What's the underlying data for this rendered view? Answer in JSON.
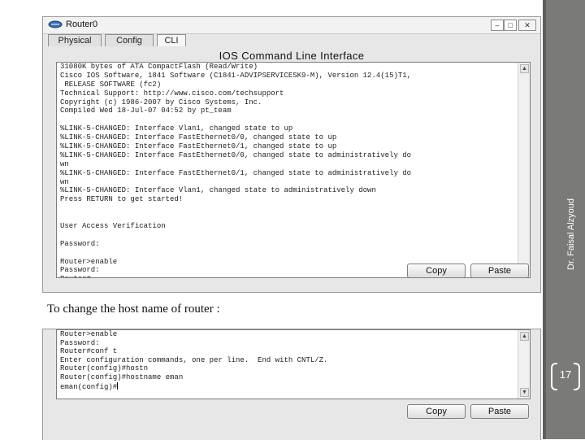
{
  "window1": {
    "title": "Router0",
    "controls": {
      "minimize": "–",
      "maximize": "□",
      "close": "✕"
    },
    "tabs": [
      "Physical",
      "Config",
      "CLI"
    ],
    "active_tab": "CLI",
    "heading": "IOS Command Line Interface",
    "terminal_lines": [
      "31080K bytes of ATA CompactFlash (Read/Write)",
      "Cisco IOS Software, 1841 Software (C1841-ADVIPSERVICESK9-M), Version 12.4(15)T1,",
      " RELEASE SOFTWARE (fc2)",
      "Technical Support: http://www.cisco.com/techsupport",
      "Copyright (c) 1986-2007 by Cisco Systems, Inc.",
      "Compiled Wed 18-Jul-07 04:52 by pt_team",
      "",
      "%LINK-5-CHANGED: Interface Vlan1, changed state to up",
      "%LINK-5-CHANGED: Interface FastEthernet0/0, changed state to up",
      "%LINK-5-CHANGED: Interface FastEthernet0/1, changed state to up",
      "%LINK-5-CHANGED: Interface FastEthernet0/0, changed state to administratively do",
      "wn",
      "%LINK-5-CHANGED: Interface FastEthernet0/1, changed state to administratively do",
      "wn",
      "%LINK-5-CHANGED: Interface Vlan1, changed state to administratively down",
      "Press RETURN to get started!",
      "",
      "",
      "User Access Verification",
      "",
      "Password:",
      "",
      "Router>enable",
      "Password:",
      "Router#"
    ],
    "copy_label": "Copy",
    "paste_label": "Paste"
  },
  "caption": "To change the host name of router :",
  "window2": {
    "terminal_lines": [
      "Router>enable",
      "Password:",
      "Router#conf t",
      "Enter configuration commands, one per line.  End with CNTL/Z.",
      "Router(config)#hostn",
      "Router(config)#hostname eman",
      "eman(config)#"
    ],
    "copy_label": "Copy",
    "paste_label": "Paste"
  },
  "slide": {
    "author": "Dr. Faisal Alzyoud",
    "page_number": "17"
  },
  "icons": {
    "app": "router-icon",
    "scroll_up": "scroll-up-arrow-icon",
    "scroll_down": "scroll-down-arrow-icon"
  }
}
